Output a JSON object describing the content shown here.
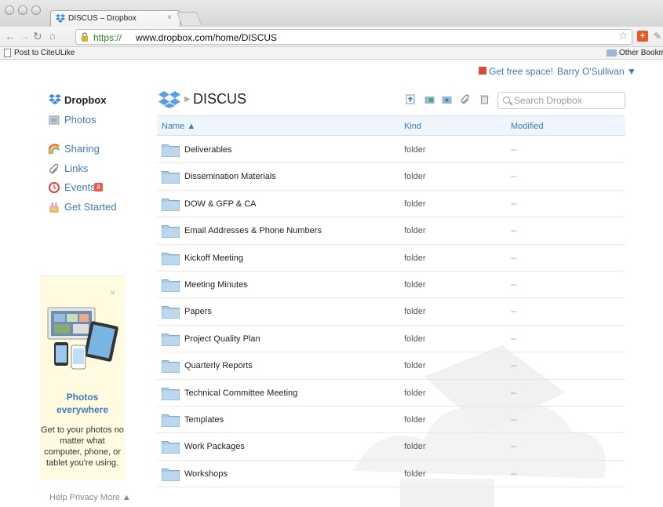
{
  "browser": {
    "tab_title": "DISCUS – Dropbox",
    "tab_close": "×",
    "url_scheme": "https://",
    "url_host": "www.dropbox.com/home/DISCUS",
    "bookmark_left": "Post to CiteULike",
    "bookmark_right": "Other Bookmarks"
  },
  "topnav": {
    "free_space": "Get free space!",
    "user": "Barry O'Sullivan ▼"
  },
  "sidebar": {
    "brand": "Dropbox",
    "items": [
      {
        "label": "Photos",
        "icon": "photos-icon"
      },
      {
        "label": "Sharing",
        "icon": "rainbow-icon"
      },
      {
        "label": "Links",
        "icon": "paperclip-icon"
      },
      {
        "label": "Events",
        "icon": "clock-icon",
        "badge": "8"
      },
      {
        "label": "Get Started",
        "icon": "cake-icon"
      }
    ],
    "promo": {
      "close": "×",
      "title": "Photos everywhere",
      "text": "Get to your photos no matter what computer, phone, or tablet you're using."
    },
    "footer": "Help  Privacy  More ▲"
  },
  "header": {
    "folder": "DISCUS",
    "search_placeholder": "Search Dropbox"
  },
  "table": {
    "columns": {
      "name": "Name ▲",
      "kind": "Kind",
      "modified": "Modified"
    },
    "rows": [
      {
        "name": "Deliverables",
        "kind": "folder",
        "modified": "--"
      },
      {
        "name": "Dissemination Materials",
        "kind": "folder",
        "modified": "--"
      },
      {
        "name": "DOW & GFP & CA",
        "kind": "folder",
        "modified": "--"
      },
      {
        "name": "Email Addresses & Phone Numbers",
        "kind": "folder",
        "modified": "--"
      },
      {
        "name": "Kickoff Meeting",
        "kind": "folder",
        "modified": "--"
      },
      {
        "name": "Meeting Minutes",
        "kind": "folder",
        "modified": "--"
      },
      {
        "name": "Papers",
        "kind": "folder",
        "modified": "--"
      },
      {
        "name": "Project Quality Plan",
        "kind": "folder",
        "modified": "--"
      },
      {
        "name": "Quarterly Reports",
        "kind": "folder",
        "modified": "--"
      },
      {
        "name": "Technical Committee Meeting",
        "kind": "folder",
        "modified": "--"
      },
      {
        "name": "Templates",
        "kind": "folder",
        "modified": "--"
      },
      {
        "name": "Work Packages",
        "kind": "folder",
        "modified": "--"
      },
      {
        "name": "Workshops",
        "kind": "folder",
        "modified": "--"
      }
    ]
  },
  "colors": {
    "link": "#3d7ab8",
    "header_bg": "#eef5fb",
    "folder": "#a9cbe8"
  }
}
